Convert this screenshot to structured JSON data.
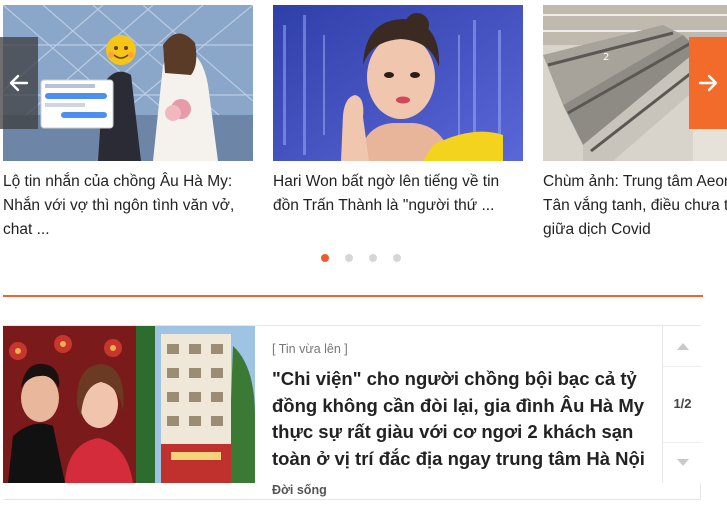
{
  "carousel": {
    "items": [
      {
        "title": "Lộ tin nhắn của chồng Âu Hà My: Nhắn với vợ thì ngôn tình văn vở, chat ...",
        "image": "wedding-photo-with-chat-screenshot"
      },
      {
        "title": "Hari Won bất ngờ lên tiếng về tin đồn Trấn Thành là \"người thứ ...",
        "image": "woman-on-tv-show-photo"
      },
      {
        "title": "Chùm ảnh: Trung tâm Aeon Bình Tân vắng tanh, điều chưa từng có giữa dịch Covid",
        "image": "empty-mall-escalators-photo"
      }
    ],
    "prev_icon": "arrow-left-icon",
    "next_icon": "arrow-right-icon",
    "dots": 4,
    "active_dot": 0
  },
  "featured": {
    "tag": "[ Tin vừa lên ]",
    "title": "\"Chi viện\" cho người chồng bội bạc cả tỷ đồng không cần đòi lại, gia đình Âu Hà My thực sự rất giàu với cơ ngơi 2 khách sạn toàn ở vị trí đắc địa ngay trung tâm Hà Nội",
    "category": "Đời sống",
    "pager": "1/2",
    "up_icon": "caret-up-icon",
    "down_icon": "caret-down-icon"
  },
  "colors": {
    "accent": "#ef6433",
    "next_arrow_bg": "#f26b2a",
    "active_dot": "#ef5a2a"
  }
}
